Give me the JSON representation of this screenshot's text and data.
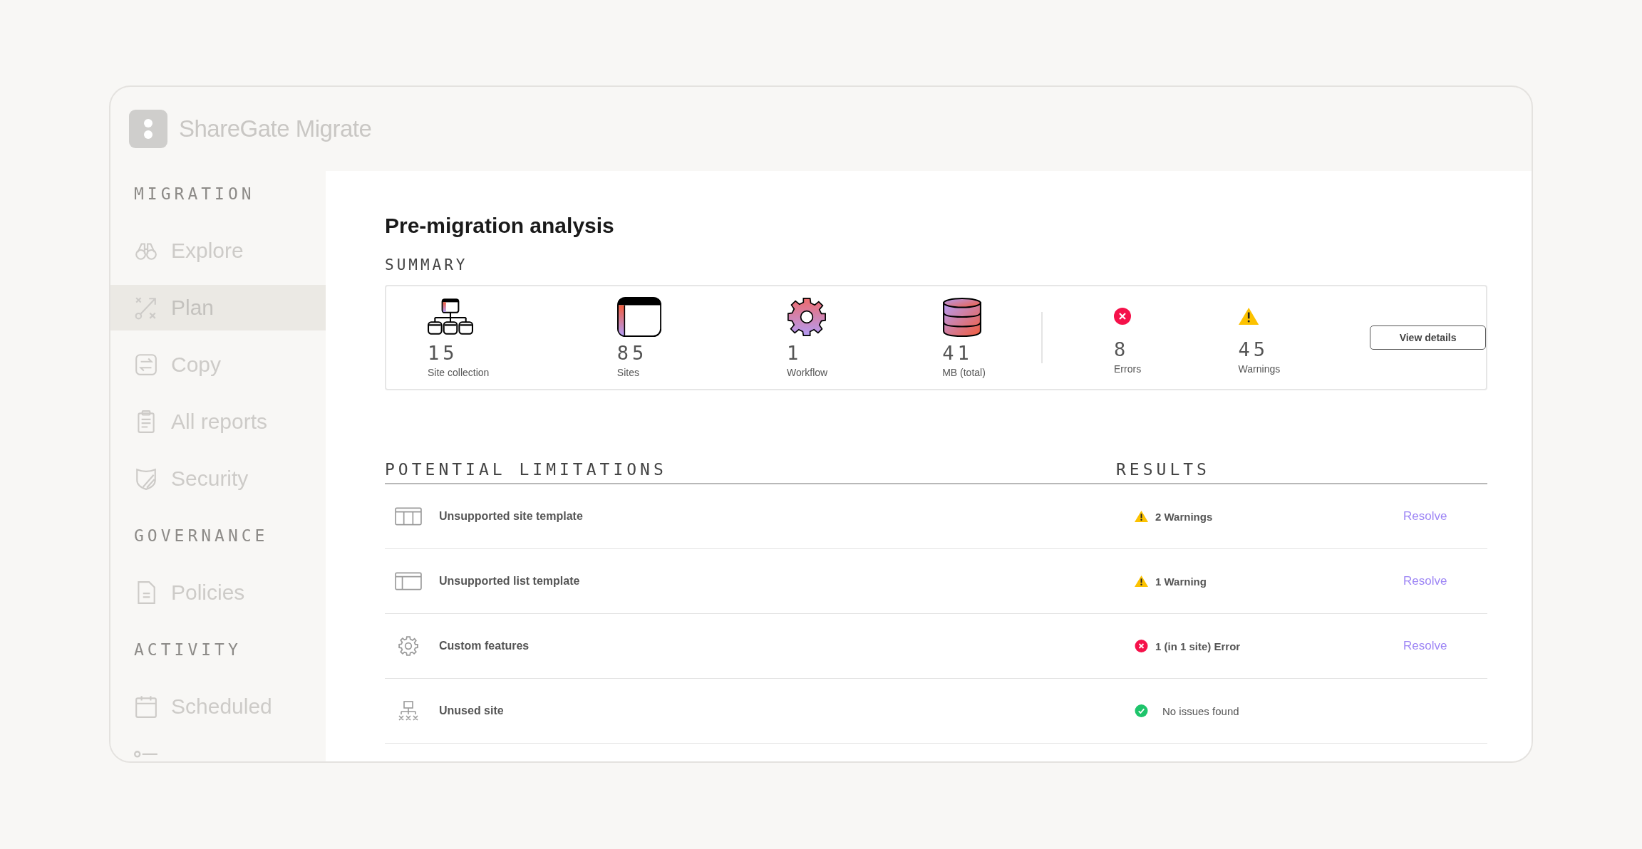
{
  "app": {
    "title": "ShareGate Migrate"
  },
  "sidebar": {
    "sections": [
      {
        "heading": "MIGRATION",
        "items": [
          {
            "label": "Explore",
            "selected": false
          },
          {
            "label": "Plan",
            "selected": true
          },
          {
            "label": "Copy",
            "selected": false
          },
          {
            "label": "All reports",
            "selected": false
          },
          {
            "label": "Security",
            "selected": false
          }
        ]
      },
      {
        "heading": "GOVERNANCE",
        "items": [
          {
            "label": "Policies",
            "selected": false
          }
        ]
      },
      {
        "heading": "ACTIVITY",
        "items": [
          {
            "label": "Scheduled",
            "selected": false
          },
          {
            "selected": false
          }
        ]
      }
    ]
  },
  "page": {
    "title": "Pre-migration analysis"
  },
  "summary": {
    "heading": "SUMMARY",
    "stats": [
      {
        "kind": "count",
        "value": "15",
        "label": "Site collection"
      },
      {
        "kind": "count",
        "value": "85",
        "label": "Sites"
      },
      {
        "kind": "count",
        "value": "1",
        "label": "Workflow"
      },
      {
        "kind": "count",
        "value": "41",
        "label": "MB (total)"
      },
      {
        "kind": "error",
        "value": "8",
        "label": "Errors"
      },
      {
        "kind": "warning",
        "value": "45",
        "label": "Warnings"
      }
    ],
    "button": "View details"
  },
  "table": {
    "columns": [
      "POTENTIAL LIMITATIONS",
      "RESULTS"
    ],
    "rows": [
      {
        "name": "Unsupported site template",
        "kind": "warning",
        "result": "2 Warnings",
        "action": "Resolve"
      },
      {
        "name": "Unsupported list template",
        "kind": "warning",
        "result": "1 Warning",
        "action": "Resolve"
      },
      {
        "name": "Custom features",
        "kind": "error",
        "result": "1 (in 1 site) Error",
        "action": "Resolve"
      },
      {
        "name": "Unused site",
        "kind": "ok",
        "result": "No issues found"
      }
    ]
  }
}
